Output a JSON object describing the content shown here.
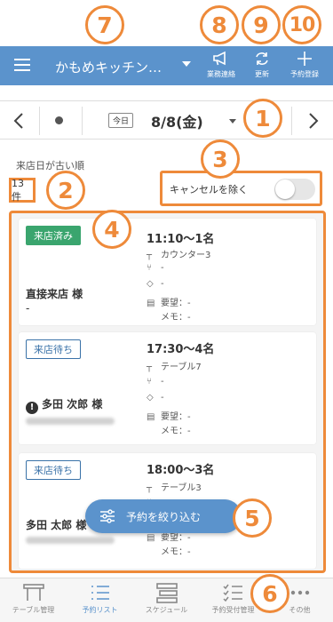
{
  "header": {
    "store_name": "かもめキッチン…",
    "buttons": [
      {
        "label": "業務連絡",
        "icon": "megaphone-icon"
      },
      {
        "label": "更新",
        "icon": "refresh-icon"
      },
      {
        "label": "予約登録",
        "icon": "plus-icon"
      }
    ]
  },
  "datebar": {
    "today_label": "今日",
    "date": "8/8(金)"
  },
  "list": {
    "sort_label": "来店日が古い順",
    "count": "13件",
    "cancel_filter_label": "キャンセルを除く",
    "cancel_filter_on": false
  },
  "reservations": [
    {
      "status": "来店済み",
      "status_type": "done",
      "time": "11:10～1名",
      "table": "カウンター3",
      "dish": "-",
      "tag": "-",
      "request": "要望：-",
      "memo": "メモ：-",
      "guest": "直接来店 様",
      "guest_sub": "-"
    },
    {
      "status": "来店待ち",
      "status_type": "wait",
      "time": "17:30～4名",
      "table": "テーブル7",
      "dish": "-",
      "tag": "-",
      "request": "要望：-",
      "memo": "メモ：-",
      "guest": "多田 次郎 様"
    },
    {
      "status": "来店待ち",
      "status_type": "wait",
      "time": "18:00～3名",
      "table": "テーブル3",
      "dish": "-",
      "tag": "-",
      "request": "要望：-",
      "memo": "メモ：-",
      "guest": "多田 太郎 様"
    }
  ],
  "filter_button": "予約を絞り込む",
  "bottom_nav": [
    {
      "label": "テーブル管理",
      "icon": "table-icon",
      "active": false
    },
    {
      "label": "予約リスト",
      "icon": "list-icon",
      "active": true
    },
    {
      "label": "スケジュール",
      "icon": "schedule-icon",
      "active": false
    },
    {
      "label": "予約受付管理",
      "icon": "checklist-icon",
      "active": false
    },
    {
      "label": "その他",
      "icon": "more-icon",
      "active": false
    }
  ],
  "callouts": [
    "1",
    "2",
    "3",
    "4",
    "5",
    "6",
    "7",
    "8",
    "9",
    "10"
  ],
  "colors": {
    "accent": "#5b93cc",
    "callout": "#ee8a3a",
    "done": "#3aa56e",
    "wait": "#3a72a8"
  }
}
